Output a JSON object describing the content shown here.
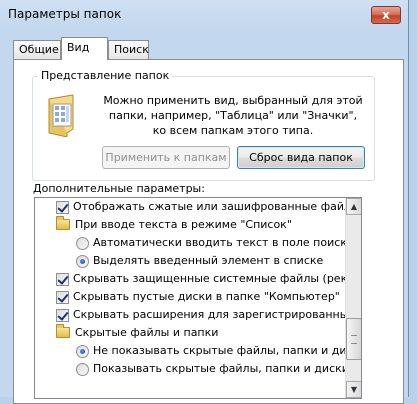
{
  "window": {
    "title": "Параметры папок",
    "close_glyph": "x"
  },
  "tabs": [
    {
      "label": "Общие"
    },
    {
      "label": "Вид"
    },
    {
      "label": "Поиск"
    }
  ],
  "folder_view": {
    "title": "Представление папок",
    "description": "Можно применить вид, выбранный для этой папки, например, \"Таблица\" или \"Значки\", ко всем папкам этого типа.",
    "apply_label": "Применить к папкам",
    "reset_label": "Сброс вида папок"
  },
  "advanced": {
    "label": "Дополнительные параметры:",
    "items": [
      {
        "type": "checkbox",
        "checked": true,
        "label": "Отображать сжатые или зашифрованные файлы NTFS"
      },
      {
        "type": "folder",
        "label": "При вводе текста в режиме \"Список\""
      },
      {
        "type": "radio",
        "checked": false,
        "label": "Автоматически вводить текст в поле поиска"
      },
      {
        "type": "radio",
        "checked": true,
        "label": "Выделять введенный элемент в списке"
      },
      {
        "type": "checkbox",
        "checked": true,
        "label": "Скрывать защищенные системные файлы (рекомендуется)"
      },
      {
        "type": "checkbox",
        "checked": true,
        "label": "Скрывать пустые диски в папке \"Компьютер\""
      },
      {
        "type": "checkbox",
        "checked": true,
        "label": "Скрывать расширения для зарегистрированных типов файлов"
      },
      {
        "type": "folder",
        "label": "Скрытые файлы и папки"
      },
      {
        "type": "radio",
        "checked": true,
        "label": "Не показывать скрытые файлы, папки и диски"
      },
      {
        "type": "radio",
        "checked": false,
        "label": "Показывать скрытые файлы, папки и диски"
      }
    ]
  },
  "scrollbar": {
    "up_glyph": "▲",
    "down_glyph": "▼"
  }
}
